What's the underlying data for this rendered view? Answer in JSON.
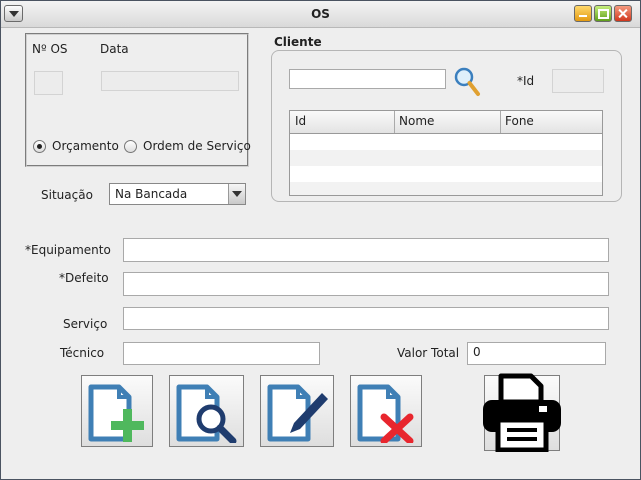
{
  "window": {
    "title": "OS"
  },
  "os_panel": {
    "num_os_label": "Nº OS",
    "data_label": "Data",
    "num_os_value": "",
    "data_value": "",
    "radio_orcamento": "Orçamento",
    "radio_ordem_servico": "Ordem de Serviço",
    "selected_radio": "Orçamento"
  },
  "cliente_panel": {
    "title": "Cliente",
    "search_value": "",
    "id_label": "*Id",
    "id_value": "",
    "columns": [
      "Id",
      "Nome",
      "Fone"
    ],
    "rows": []
  },
  "situacao": {
    "label": "Situação",
    "selected": "Na Bancada"
  },
  "form": {
    "equipamento_label": "*Equipamento",
    "equipamento_value": "",
    "defeito_label": "*Defeito",
    "defeito_value": "",
    "servico_label": "Serviço",
    "servico_value": "",
    "tecnico_label": "Técnico",
    "tecnico_value": "",
    "valor_total_label": "Valor Total",
    "valor_total_value": "0"
  },
  "actions": {
    "icons": [
      "add-document-icon",
      "search-document-icon",
      "edit-document-icon",
      "delete-document-icon",
      "printer-icon"
    ]
  },
  "colors": {
    "doc_blue": "#3f7fb5",
    "add_green": "#4fb85d",
    "delete_red": "#e8262e",
    "search_navy": "#1f3c6e"
  }
}
